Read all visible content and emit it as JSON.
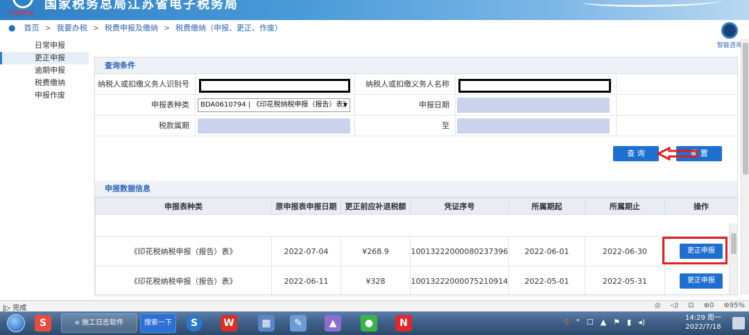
{
  "banner": {
    "title": "国家税务总局江苏省电子税务局",
    "logo_sub": "中国税务"
  },
  "breadcrumb": {
    "items": [
      "首页",
      "我要办税",
      "税费申报及缴纳",
      "税费缴纳（申报、更正、作废）"
    ]
  },
  "sidenav": {
    "items": [
      "日常申报",
      "更正申报",
      "逾期申报",
      "税费缴纳",
      "申报作废"
    ],
    "active_index": 1
  },
  "assistant": {
    "label": "智能咨询"
  },
  "query": {
    "section_title": "查询条件",
    "taxpayer_id_label": "纳税人或扣缴义务人识别号",
    "taxpayer_name_label": "纳税人或扣缴义务人名称",
    "form_type_label": "申报表种类",
    "form_type_value": "BDA0610794 | 《印花税纳税申报（报告）表》",
    "declare_date_label": "申报日期",
    "tax_period_label": "税款属期",
    "to_label": "至",
    "search_button": "查 询",
    "reset_button": "重 置"
  },
  "results": {
    "section_title": "申报数据信息",
    "columns": [
      "申报表种类",
      "原申报表申报日期",
      "更正前应补退税额",
      "凭证序号",
      "所属期起",
      "所属期止",
      "操作"
    ],
    "rows": [
      {
        "form": "《印花税纳税申报（报告）表》",
        "date": "2022-07-04",
        "amount": "¥268.9",
        "voucher": "10013222000080237396",
        "start": "2022-06-01",
        "end": "2022-06-30",
        "action": "更正申报"
      },
      {
        "form": "《印花税纳税申报（报告）表》",
        "date": "2022-06-11",
        "amount": "¥328",
        "voucher": "10013222000075210914",
        "start": "2022-05-01",
        "end": "2022-05-31",
        "action": "更正申报"
      }
    ]
  },
  "statusbar": {
    "left": "完成",
    "zoom": "95%",
    "counter": "0"
  },
  "taskbar": {
    "app_label": "施工日志软件",
    "search_label": "搜索一下",
    "clock_time": "14:29 周一",
    "clock_date": "2022/7/18"
  },
  "colors": {
    "accent": "#1f6fd0",
    "highlight": "#e02020",
    "banner": "#2f7fc6"
  }
}
